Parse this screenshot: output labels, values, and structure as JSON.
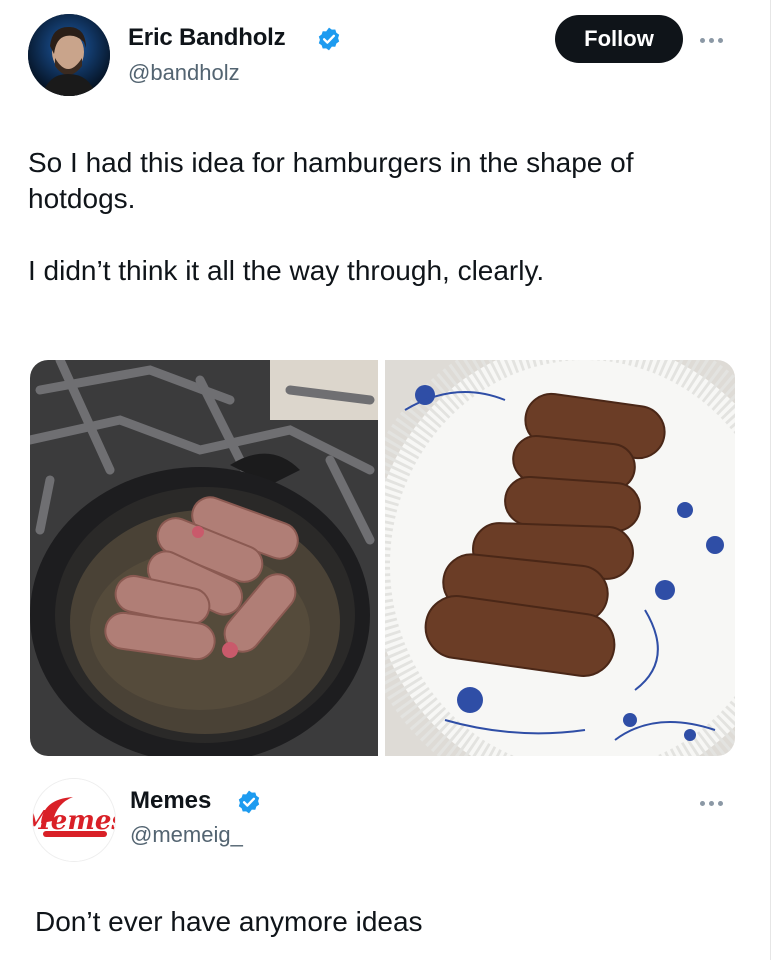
{
  "tweet": {
    "author_name": "Eric Bandholz",
    "author_handle": "@bandholz",
    "follow_label": "Follow",
    "text": "So I had this idea for hamburgers in the shape of\nhotdogs.\n\nI didn’t think it all the way through, clearly."
  },
  "quote": {
    "author_name": "Memes",
    "author_handle": "@memeig_",
    "logo_text": "Memes",
    "text": "Don’t ever have anymore ideas"
  },
  "icons": {
    "verified": "verified-badge-icon",
    "more": "more-options-icon"
  },
  "colors": {
    "verified_blue": "#1d9bf0",
    "follow_bg": "#0f1419",
    "secondary_text": "#536471",
    "memes_red": "#d92027"
  }
}
